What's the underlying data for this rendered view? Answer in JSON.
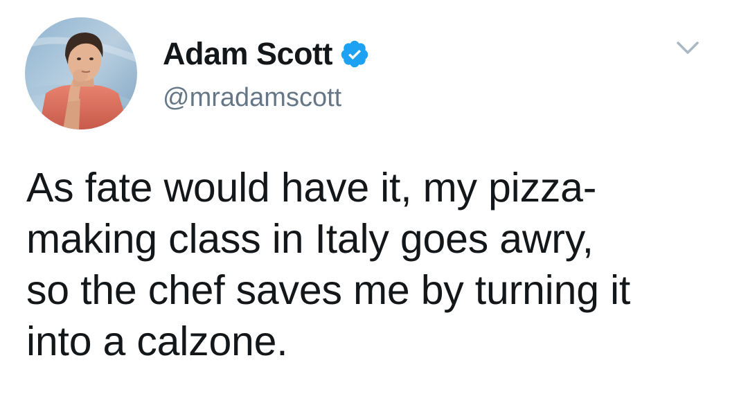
{
  "author": {
    "display_name": "Adam Scott",
    "handle": "@mradamscott",
    "verified": true,
    "avatar_icon": "profile-photo"
  },
  "tweet": {
    "text_lines": [
      "As fate would have it, my pizza-",
      "making class in Italy goes awry,",
      "so the chef saves me by turning it",
      "into a calzone."
    ]
  },
  "icons": {
    "verified": "verified-badge-icon",
    "menu": "chevron-down-icon"
  },
  "colors": {
    "verified_blue": "#1da1f2",
    "handle_gray": "#657786",
    "caret_gray": "#aab8c2",
    "text": "#14171a"
  }
}
